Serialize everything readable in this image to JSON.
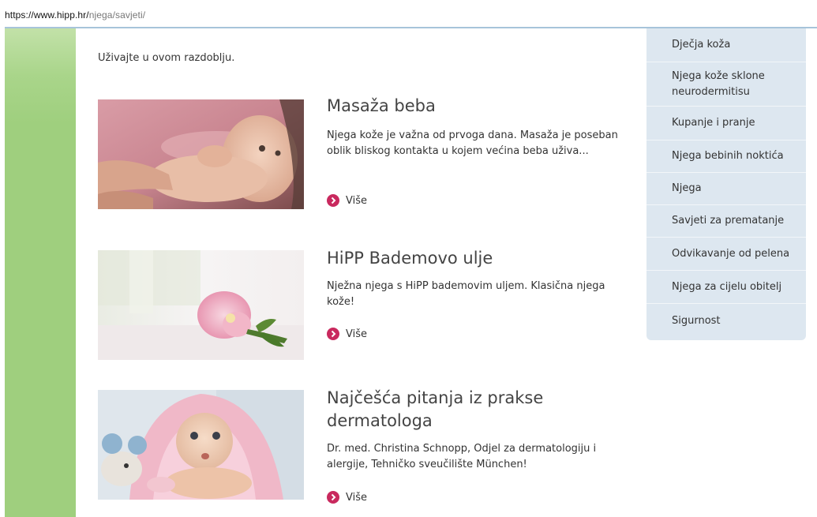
{
  "browser": {
    "url_host": "https://www.hipp.hr/",
    "url_path": "njega/savjeti/"
  },
  "intro_text": "Uživajte u ovom razdoblju.",
  "articles": [
    {
      "title": "Masaža beba",
      "description": "Njega kože je važna od prvoga dana. Masaža je poseban oblik bliskog kontakta u kojem većina beba uživa...",
      "more_label": "Više"
    },
    {
      "title": "HiPP Bademovo ulje",
      "description": "Nježna njega s HiPP bademovim uljem. Klasična njega kože!",
      "more_label": "Više"
    },
    {
      "title": "Najčešća pitanja iz prakse dermatologa",
      "description": "Dr. med. Christina Schnopp, Odjel za dermatologiju i alergije, Tehničko sveučilište München!",
      "more_label": "Više"
    }
  ],
  "sidebar": {
    "items": [
      {
        "label": "Dječja koža"
      },
      {
        "label": "Njega kože sklone neurodermitisu"
      },
      {
        "label": "Kupanje i pranje"
      },
      {
        "label": "Njega bebinih noktića"
      },
      {
        "label": "Njega"
      },
      {
        "label": "Savjeti za prematanje"
      },
      {
        "label": "Odvikavanje od pelena"
      },
      {
        "label": "Njega za cijelu obitelj"
      },
      {
        "label": "Sigurnost"
      }
    ]
  },
  "colors": {
    "accent": "#c9295e",
    "left_bar_green": "#9fcf7e",
    "sidebar_bg": "#dde7f0"
  },
  "icons": {
    "more": "chevron-right-circle-icon"
  }
}
